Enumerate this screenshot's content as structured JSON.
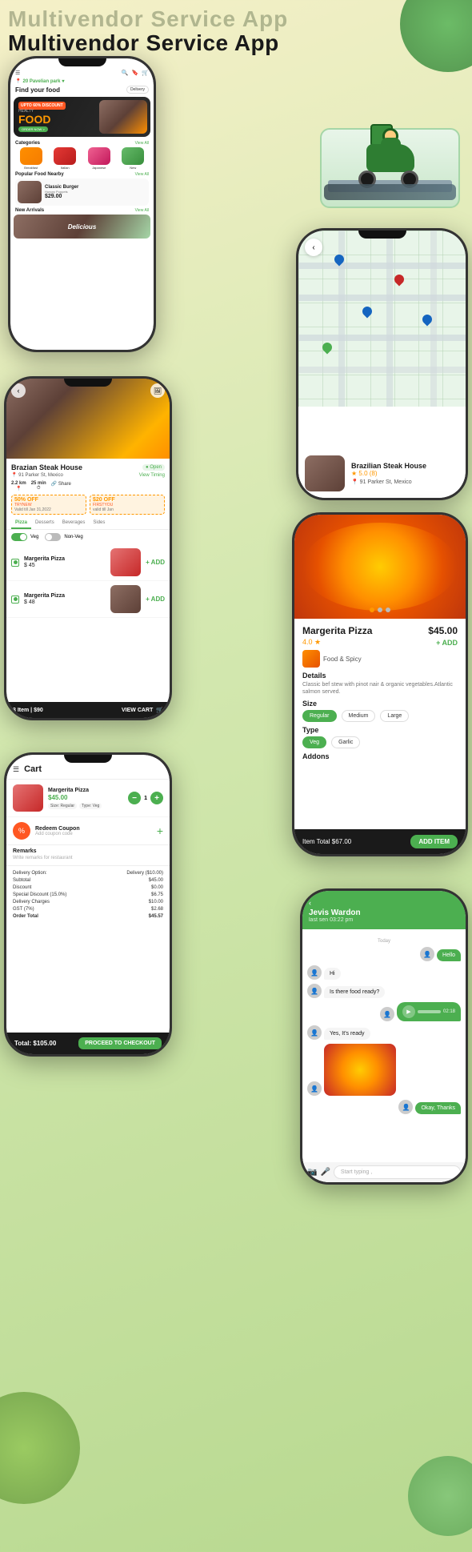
{
  "app": {
    "title_shadow": "Multivendor Service App",
    "title": "Multivendor Service App"
  },
  "phone1": {
    "location": "20 Pavelian park",
    "find_food": "Find your food",
    "delivery": "Delivery",
    "banner": {
      "discount": "UPTO 60% DISCOUNT",
      "healty": "HEALTY",
      "food": "FOOD",
      "order_now": "ORDER NOW >"
    },
    "categories": {
      "title": "Categories",
      "view_all": "View All",
      "items": [
        "Breakfast",
        "Italian",
        "Japanese",
        "New"
      ]
    },
    "popular": {
      "title": "Popular Food Nearby",
      "view_all": "View All",
      "item_name": "Classic Burger",
      "item_sub": "Hungry Puppets",
      "item_price": "$29.00"
    },
    "new_arrivals": {
      "title": "New Arrivals",
      "view_all": "View All",
      "label": "Delicious"
    }
  },
  "phone2": {
    "restaurant": {
      "name": "Brazilian Steak House",
      "rating": "5.0 (8)",
      "address": "91 Parker St, Mexico"
    }
  },
  "phone3": {
    "restaurant_name": "Brazian Steak House",
    "status": "Open",
    "address": "91 Parker St, Mexico",
    "view_timing": "View Timing",
    "stats": {
      "distance": "2.2 km",
      "time": "25 min",
      "share": "Share"
    },
    "coupons": [
      {
        "off": "50% OFF",
        "code": "TRYNEW",
        "valid": "Valid till Jan 31,2022"
      },
      {
        "off": "$20 OFF",
        "code": "FIRSTYOU",
        "valid": "valid till Jan"
      }
    ],
    "tabs": [
      "Pizza",
      "Desserts",
      "Beverages",
      "Sides"
    ],
    "active_tab": "Pizza",
    "menu_items": [
      {
        "name": "Margerita Pizza",
        "price": "$ 45"
      },
      {
        "name": "Margerita Pizza",
        "price": "$ 48"
      }
    ],
    "cart_count": "3 Item | $90",
    "view_cart": "VIEW CART"
  },
  "phone4": {
    "name": "Margerita Pizza",
    "price": "$45.00",
    "rating": "4.0 ★",
    "add_btn": "+ ADD",
    "category": "Food & Spicy",
    "details_title": "Details",
    "details_text": "Classic bef stew with pinot nair & organic vegetables.Atlantic salmon served.",
    "size_title": "Size",
    "sizes": [
      "Regular",
      "Medium",
      "Large"
    ],
    "active_size": "Regular",
    "type_title": "Type",
    "types": [
      "Veg",
      "Garlic"
    ],
    "active_type": "Veg",
    "addons_title": "Addons",
    "item_total_label": "Item Total $67.00",
    "add_item_btn": "ADD ITEM"
  },
  "phone5": {
    "title": "Cart",
    "item": {
      "name": "Margerita Pizza",
      "price": "$45.00",
      "tags": [
        "Size: Regular",
        "Type: Veg"
      ],
      "qty": "1"
    },
    "coupon": {
      "title": "Redeem Coupon",
      "sub": "Add coupon code"
    },
    "remarks": {
      "title": "Remarks",
      "placeholder": "Write remarks for restaurant"
    },
    "bill": [
      {
        "label": "Delivery Option:",
        "value": "Delivery ($10.00)"
      },
      {
        "label": "Subtotal",
        "value": "$45.00"
      },
      {
        "label": "Discount",
        "value": "$0.00"
      },
      {
        "label": "Special Discount (15.0%)",
        "value": "$6.75"
      },
      {
        "label": "Delivery Charges",
        "value": "$10.00"
      },
      {
        "label": "GST (7%)",
        "value": "$2.68"
      },
      {
        "label": "Order Total",
        "value": "$45.57"
      }
    ],
    "total": "Total: $105.00",
    "checkout_btn": "PROCEED TO CHECKOUT"
  },
  "phone6": {
    "contact_name": "Jevis Wardon",
    "contact_status": "last sen 03:22 pm",
    "date_divider": "Today",
    "messages": [
      {
        "type": "sent",
        "text": "Hello"
      },
      {
        "type": "received",
        "text": "Hi"
      },
      {
        "type": "received",
        "text": "Is there food ready?"
      },
      {
        "type": "sent",
        "voice": true,
        "duration": "02:18"
      },
      {
        "type": "received",
        "text": "Yes, It's ready"
      },
      {
        "type": "received",
        "image": true
      },
      {
        "type": "sent",
        "text": "Okay, Thanks"
      }
    ],
    "input_placeholder": "Start typing ,"
  }
}
